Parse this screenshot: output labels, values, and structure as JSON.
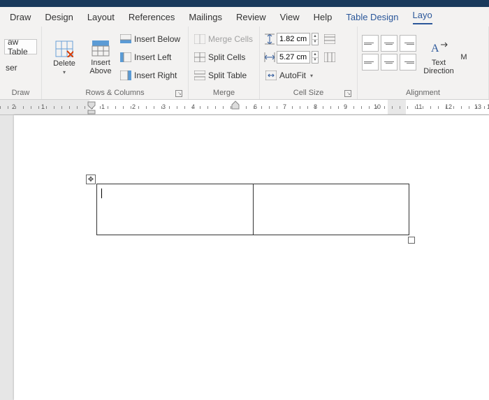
{
  "menu": {
    "draw": "Draw",
    "design": "Design",
    "layout": "Layout",
    "references": "References",
    "mailings": "Mailings",
    "review": "Review",
    "view": "View",
    "help": "Help",
    "table_design": "Table Design",
    "layout_tab": "Layo"
  },
  "ribbon": {
    "draw_group": {
      "draw_table": "aw Table",
      "eraser": "ser",
      "label": "Draw"
    },
    "rows_cols": {
      "delete": "Delete",
      "insert_above": "Insert\nAbove",
      "insert_below": "Insert Below",
      "insert_left": "Insert Left",
      "insert_right": "Insert Right",
      "label": "Rows & Columns"
    },
    "merge": {
      "merge_cells": "Merge Cells",
      "split_cells": "Split Cells",
      "split_table": "Split Table",
      "label": "Merge"
    },
    "cell_size": {
      "height": "1.82 cm",
      "width": "5.27 cm",
      "autofit": "AutoFit",
      "label": "Cell Size"
    },
    "alignment": {
      "text_direction": "Text\nDirection",
      "cell_margins": "M",
      "label": "Alignment"
    }
  },
  "ruler": {
    "numbers": [
      "2",
      "1",
      "1",
      "2",
      "3",
      "4",
      "6",
      "7",
      "8",
      "9",
      "10",
      "11",
      "12",
      "13",
      "1"
    ]
  }
}
